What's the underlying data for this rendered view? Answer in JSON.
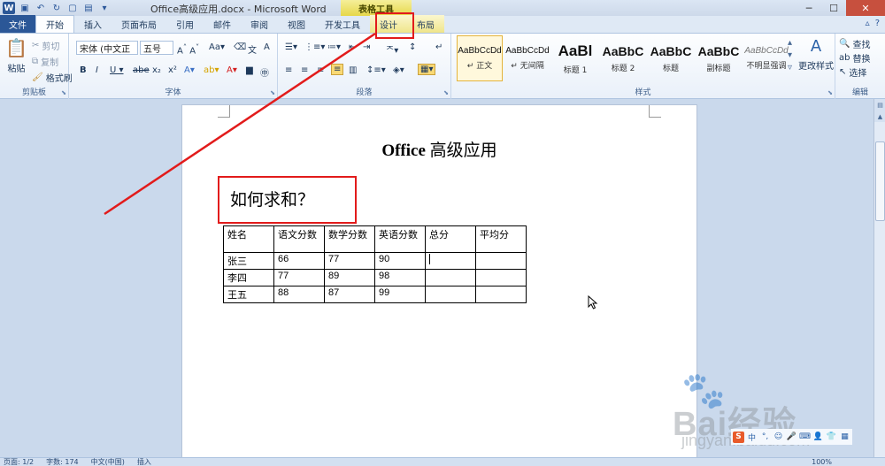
{
  "window": {
    "title": "Office高级应用.docx - Microsoft Word",
    "context_tab_title": "表格工具",
    "min_icon": "minimize-icon",
    "max_icon": "maximize-icon",
    "close_icon": "close-icon"
  },
  "tabs": [
    {
      "label": "文件"
    },
    {
      "label": "开始"
    },
    {
      "label": "插入"
    },
    {
      "label": "页面布局"
    },
    {
      "label": "引用"
    },
    {
      "label": "邮件"
    },
    {
      "label": "审阅"
    },
    {
      "label": "视图"
    },
    {
      "label": "开发工具"
    },
    {
      "label": "设计"
    },
    {
      "label": "布局"
    }
  ],
  "ribbon": {
    "clipboard": {
      "paste": "粘贴",
      "cut": "剪切",
      "copy": "复制",
      "format_painter": "格式刷",
      "group": "剪贴板"
    },
    "font": {
      "font_name": "宋体 (中文正",
      "font_size": "五号",
      "group": "字体"
    },
    "paragraph": {
      "group": "段落"
    },
    "styles": {
      "group": "样式",
      "items": [
        {
          "preview": "AaBbCcDd",
          "name": "↵ 正文"
        },
        {
          "preview": "AaBbCcDd",
          "name": "↵ 无间隔"
        },
        {
          "preview": "AaBl",
          "name": "标题 1"
        },
        {
          "preview": "AaBbC",
          "name": "标题 2"
        },
        {
          "preview": "AaBbC",
          "name": "标题"
        },
        {
          "preview": "AaBbC",
          "name": "副标题"
        },
        {
          "preview": "AaBbCcDd",
          "name": "不明显强调"
        }
      ],
      "change_styles": "更改样式"
    },
    "editing": {
      "find": "查找",
      "replace": "替换",
      "select": "选择",
      "group": "编辑"
    }
  },
  "document": {
    "title_latin": "Office",
    "title_cn": "高级应用",
    "question": "如何求和？",
    "table": {
      "headers": [
        "姓名",
        "语文分数",
        "数学分数",
        "英语分数",
        "总分",
        "平均分"
      ],
      "rows": [
        [
          "张三",
          "66",
          "77",
          "90",
          "",
          ""
        ],
        [
          "李四",
          "77",
          "89",
          "98",
          "",
          ""
        ],
        [
          "王五",
          "88",
          "87",
          "99",
          "",
          ""
        ]
      ]
    }
  },
  "statusbar": {
    "page": "页面: 1/2",
    "words": "字数: 174",
    "language": "中文(中国)",
    "mode": "插入",
    "zoom": "100%"
  },
  "watermark": {
    "text": "Bai经验",
    "url": "jingyan.baidu.com"
  },
  "annotation": {
    "color": "#e21b1b"
  }
}
